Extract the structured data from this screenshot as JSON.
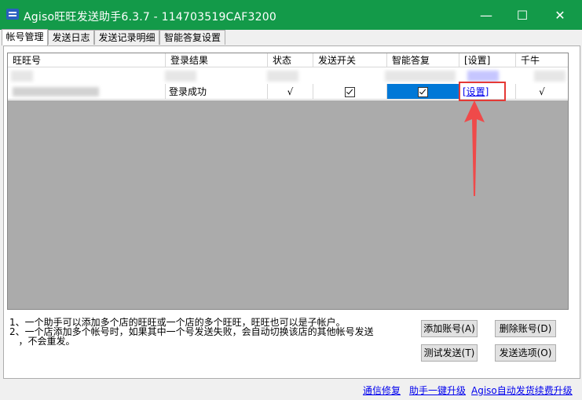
{
  "window": {
    "title": "Agiso旺旺发送助手6.3.7 - 114703519CAF3200",
    "minimize": "—",
    "maximize": "☐",
    "close": "✕"
  },
  "tabs": [
    {
      "label": "帐号管理",
      "active": true
    },
    {
      "label": "发送日志",
      "active": false
    },
    {
      "label": "发送记录明细",
      "active": false
    },
    {
      "label": "智能答复设置",
      "active": false
    }
  ],
  "table": {
    "columns": [
      "旺旺号",
      "登录结果",
      "状态",
      "发送开关",
      "智能答复",
      "[设置]",
      "千牛"
    ],
    "rows": [
      {
        "account": "",
        "login_result": "登录成功",
        "status": "√",
        "send_switch": true,
        "smart_reply": true,
        "settings": "[设置]",
        "qianniu": "√"
      }
    ]
  },
  "notes": [
    "1、一个助手可以添加多个店的旺旺或一个店的多个旺旺，旺旺也可以是子帐户。",
    "2、一个店添加多个帐号时，如果其中一个号发送失败，会自动切换该店的其他帐号发送",
    "   ，不会重发。"
  ],
  "buttons": {
    "add_account": "添加账号(A)",
    "delete_account": "删除账号(D)",
    "test_send": "测试发送(T)",
    "send_options": "发送选项(O)"
  },
  "footer": {
    "repair": "通信修复",
    "upgrade": "助手一键升级",
    "renew": "Agiso自动发货续费升级"
  },
  "colors": {
    "titlebar": "#139a49",
    "selection": "#0078d7",
    "highlight_annotation": "#e53935"
  }
}
